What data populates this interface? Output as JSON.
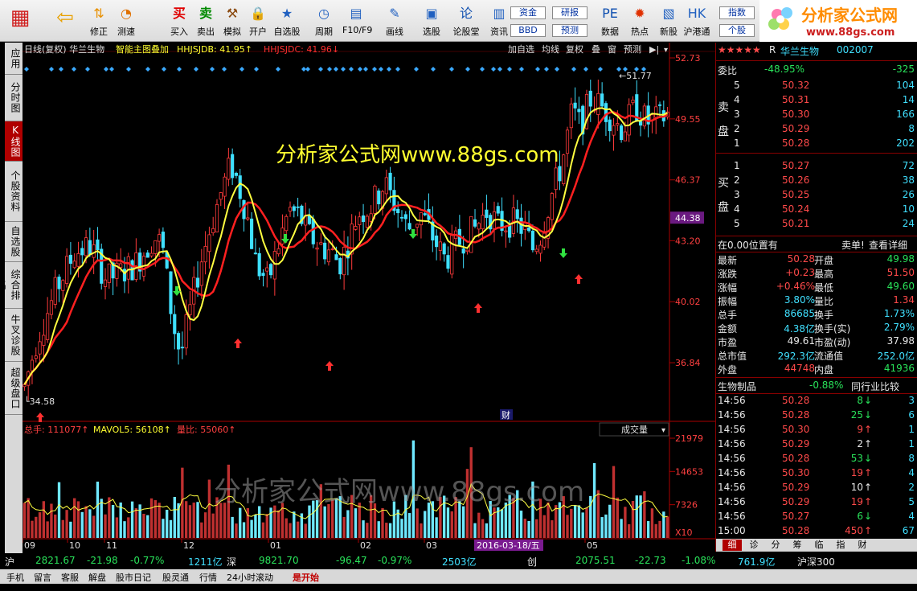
{
  "toolbar": {
    "buttons": [
      {
        "label": "",
        "icon": "grid-icon"
      },
      {
        "label": "",
        "icon": "back-arrow-icon"
      },
      {
        "label": "修正",
        "icon": "up-down-arrows-icon"
      },
      {
        "label": "测速",
        "icon": "gauge-icon"
      },
      {
        "label": "买入",
        "icon": "buy-icon"
      },
      {
        "label": "卖出",
        "icon": "sell-icon"
      },
      {
        "label": "模拟",
        "icon": "hammer-icon"
      },
      {
        "label": "开户",
        "icon": "lock-icon"
      },
      {
        "label": "自选股",
        "icon": "star-icon"
      },
      {
        "label": "周期",
        "icon": "clock-icon"
      },
      {
        "label": "F10/F9",
        "icon": "document-icon"
      },
      {
        "label": "画线",
        "icon": "pen-icon"
      },
      {
        "label": "选股",
        "icon": "screener-icon"
      },
      {
        "label": "论股堂",
        "icon": "forum-icon"
      },
      {
        "label": "资讯",
        "icon": "news-icon"
      },
      {
        "label": "数据",
        "icon": "pe-icon"
      },
      {
        "label": "热点",
        "icon": "hot-icon"
      },
      {
        "label": "新股",
        "icon": "new-stock-icon"
      },
      {
        "label": "沪港通",
        "icon": "hk-connect-icon"
      }
    ],
    "boxes": [
      "资金",
      "BBD",
      "研报",
      "预测",
      "指数",
      "个股"
    ],
    "buy_glyph": "买",
    "sell_glyph": "卖"
  },
  "logo": {
    "title": "分析家公式网",
    "url": "www.88gs.com"
  },
  "side_tabs": [
    "应用",
    "分时图",
    "K线图",
    "个股资料",
    "自选股",
    "综合排名",
    "牛叉诊股",
    "超级盘口"
  ],
  "chart": {
    "header_left": "日线(复权)  华兰生物",
    "indicator_name": "智能主图叠加",
    "hhjsjdb": "HHJSJDB: 41.95",
    "hhjsjdc": "HHJSJDC: 41.96",
    "top_buttons": [
      "加自选",
      "均线",
      "复权",
      "叠",
      "窗",
      "预测"
    ],
    "watermark": "分析家公式网www.88gs.com",
    "price_ticks": [
      "52.73",
      "49.55",
      "46.37",
      "43.20",
      "40.02",
      "36.84"
    ],
    "current_price_tag": "44.38",
    "high_label": "51.77",
    "low_label": "34.58",
    "cai_label": "财",
    "vol_header": {
      "total": "总手: 111077",
      "mavol": "MAVOL5: 56108",
      "ratio": "量比: 55060"
    },
    "vol_dropdown": "成交量",
    "vol_ticks": [
      "21979",
      "14653",
      "7326"
    ],
    "vol_unit": "X10",
    "month_labels": [
      "09",
      "10",
      "11",
      "12",
      "01",
      "02",
      "03",
      "05"
    ],
    "date_marker": "2016-03-18/五",
    "vol_watermark": "分析家公式网www.88gs.com"
  },
  "right_panel": {
    "stars": "★★★★★",
    "flag": "R",
    "stock_name": "华兰生物",
    "stock_code": "002007",
    "weibi_label": "委比",
    "weibi": "-48.95%",
    "weicha": "-325",
    "sell_label": "卖\n盘",
    "buy_label": "买\n盘",
    "asks": [
      {
        "lvl": "5",
        "price": "50.32",
        "vol": "104"
      },
      {
        "lvl": "4",
        "price": "50.31",
        "vol": "14"
      },
      {
        "lvl": "3",
        "price": "50.30",
        "vol": "166"
      },
      {
        "lvl": "2",
        "price": "50.29",
        "vol": "8"
      },
      {
        "lvl": "1",
        "price": "50.28",
        "vol": "202"
      }
    ],
    "bids": [
      {
        "lvl": "1",
        "price": "50.27",
        "vol": "72"
      },
      {
        "lvl": "2",
        "price": "50.26",
        "vol": "38"
      },
      {
        "lvl": "3",
        "price": "50.25",
        "vol": "26"
      },
      {
        "lvl": "4",
        "price": "50.24",
        "vol": "10"
      },
      {
        "lvl": "5",
        "price": "50.21",
        "vol": "24"
      }
    ],
    "position_info": "在0.00位置有",
    "sell_order": "卖单!",
    "detail_link": "查看详细",
    "stats": [
      {
        "l1": "最新",
        "v1": "50.28",
        "c1": "r",
        "l2": "开盘",
        "v2": "49.98",
        "c2": "g"
      },
      {
        "l1": "涨跌",
        "v1": "+0.23",
        "c1": "r",
        "l2": "最高",
        "v2": "51.50",
        "c2": "r"
      },
      {
        "l1": "涨幅",
        "v1": "+0.46%",
        "c1": "r",
        "l2": "最低",
        "v2": "49.60",
        "c2": "g"
      },
      {
        "l1": "振幅",
        "v1": "3.80%",
        "c1": "c",
        "l2": "量比",
        "v2": "1.34",
        "c2": "r"
      },
      {
        "l1": "总手",
        "v1": "86685",
        "c1": "c",
        "l2": "换手",
        "v2": "1.73%",
        "c2": "c"
      },
      {
        "l1": "金额",
        "v1": "4.38亿",
        "c1": "c",
        "l2": "换手(实)",
        "v2": "2.79%",
        "c2": "c"
      },
      {
        "l1": "市盈",
        "v1": "49.61",
        "c1": "w",
        "l2": "市盈(动)",
        "v2": "37.98",
        "c2": "w"
      },
      {
        "l1": "总市值",
        "v1": "292.3亿",
        "c1": "c",
        "l2": "流通值",
        "v2": "252.0亿",
        "c2": "c"
      },
      {
        "l1": "外盘",
        "v1": "44748",
        "c1": "r",
        "l2": "内盘",
        "v2": "41936",
        "c2": "g"
      }
    ],
    "industry": "生物制品",
    "industry_chg": "-0.88%",
    "industry_cmp": "同行业比较",
    "ticks": [
      {
        "time": "14:56",
        "price": "50.28",
        "pc": "r",
        "vol": "8",
        "dir": "down",
        "n": "3"
      },
      {
        "time": "14:56",
        "price": "50.28",
        "pc": "r",
        "vol": "25",
        "dir": "down",
        "n": "6"
      },
      {
        "time": "14:56",
        "price": "50.30",
        "pc": "r",
        "vol": "9",
        "dir": "up",
        "n": "1"
      },
      {
        "time": "14:56",
        "price": "50.29",
        "pc": "r",
        "vol": "2",
        "dir": "upw",
        "n": "1"
      },
      {
        "time": "14:56",
        "price": "50.28",
        "pc": "r",
        "vol": "53",
        "dir": "down",
        "n": "8"
      },
      {
        "time": "14:56",
        "price": "50.30",
        "pc": "r",
        "vol": "19",
        "dir": "up",
        "n": "4"
      },
      {
        "time": "14:56",
        "price": "50.29",
        "pc": "r",
        "vol": "10",
        "dir": "upw",
        "n": "2"
      },
      {
        "time": "14:56",
        "price": "50.29",
        "pc": "r",
        "vol": "19",
        "dir": "up",
        "n": "5"
      },
      {
        "time": "14:56",
        "price": "50.27",
        "pc": "r",
        "vol": "6",
        "dir": "down",
        "n": "4"
      },
      {
        "time": "15:00",
        "price": "50.28",
        "pc": "r",
        "vol": "450",
        "dir": "up",
        "n": "67"
      }
    ],
    "bottom_tabs": [
      "细",
      "诊",
      "分",
      "筹",
      "临",
      "指",
      "财"
    ]
  },
  "bottom": {
    "index_row": [
      {
        "t": "沪",
        "c": "w"
      },
      {
        "t": "2821.67",
        "c": "g"
      },
      {
        "t": "-21.98",
        "c": "g"
      },
      {
        "t": "-0.77%",
        "c": "g"
      },
      {
        "t": "1211亿",
        "c": "c"
      },
      {
        "t": "深",
        "c": "w"
      },
      {
        "t": "9821.70",
        "c": "g"
      },
      {
        "t": "-96.47",
        "c": "g"
      },
      {
        "t": "-0.97%",
        "c": "g"
      },
      {
        "t": "2503亿",
        "c": "c"
      },
      {
        "t": "创",
        "c": "w"
      },
      {
        "t": "2075.51",
        "c": "g"
      },
      {
        "t": "-22.73",
        "c": "g"
      },
      {
        "t": "-1.08%",
        "c": "g"
      },
      {
        "t": "761.9亿",
        "c": "c"
      },
      {
        "t": "沪深300",
        "c": "w"
      }
    ],
    "menu": [
      "手机",
      "留言",
      "客服",
      "解盘",
      "股市日记",
      "股灵通",
      "行情",
      "24小时滚动",
      "是开始"
    ]
  }
}
